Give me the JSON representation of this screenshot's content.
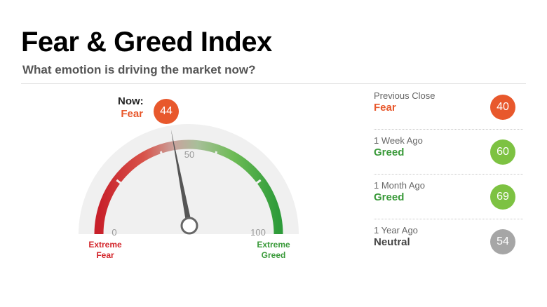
{
  "header": {
    "title": "Fear & Greed Index",
    "subtitle": "What emotion is driving the market now?"
  },
  "gauge": {
    "now_label": "Now:",
    "now_sentiment": "Fear",
    "now_value": "44",
    "value": 44,
    "min": 0,
    "max": 100,
    "tick_min": "0",
    "tick_mid": "50",
    "tick_max": "100",
    "extreme_fear_line1": "Extreme",
    "extreme_fear_line2": "Fear",
    "extreme_greed_line1": "Extreme",
    "extreme_greed_line2": "Greed"
  },
  "history": [
    {
      "label": "Previous Close",
      "sentiment": "Fear",
      "value": "40",
      "sentiment_color": "#e8582c",
      "badge_color": "#e8582c"
    },
    {
      "label": "1 Week Ago",
      "sentiment": "Greed",
      "value": "60",
      "sentiment_color": "#3a9a3a",
      "badge_color": "#7dc242"
    },
    {
      "label": "1 Month Ago",
      "sentiment": "Greed",
      "value": "69",
      "sentiment_color": "#3a9a3a",
      "badge_color": "#7dc242"
    },
    {
      "label": "1 Year Ago",
      "sentiment": "Neutral",
      "value": "54",
      "sentiment_color": "#444444",
      "badge_color": "#a6a6a6"
    }
  ],
  "colors": {
    "fear_badge": "#e8582c",
    "extreme_fear_text": "#d3262b",
    "extreme_greed_text": "#3a9a3a"
  }
}
